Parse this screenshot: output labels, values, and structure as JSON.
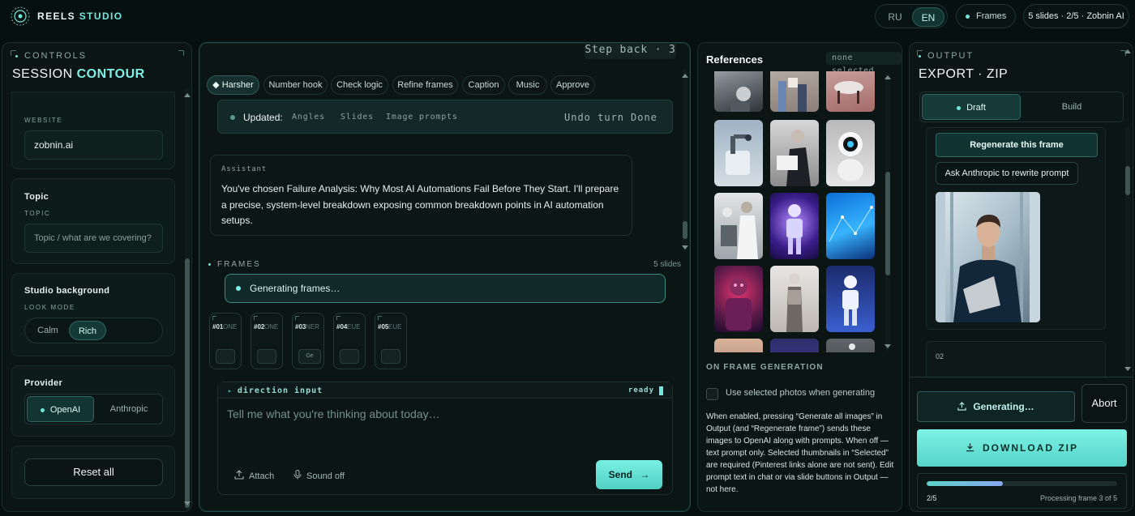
{
  "brand": {
    "name": "REELS",
    "accent": "STUDIO"
  },
  "topbar": {
    "lang_ru": "RU",
    "lang_en": "EN",
    "frames_label": "Frames",
    "status": "5 slides · 2/5 · Zobnin AI"
  },
  "controls": {
    "eyebrow": "CONTROLS",
    "title_plain": "SESSION",
    "title_accent": "CONTOUR",
    "website_label": "WEBSITE",
    "website_value": "zobnin.ai",
    "topic_title": "Topic",
    "topic_label": "TOPIC",
    "topic_placeholder": "Topic / what are we covering?",
    "bg_title": "Studio background",
    "look_label": "LOOK MODE",
    "look_calm": "Calm",
    "look_rich": "Rich",
    "provider_title": "Provider",
    "provider_openai": "OpenAI",
    "provider_anthropic": "Anthropic",
    "reset": "Reset all"
  },
  "center": {
    "step_back": "Step back · 3",
    "chips": [
      "◆ Harsher",
      "Number hook",
      "Check logic",
      "Refine frames",
      "Caption",
      "Music",
      "Approve"
    ],
    "updated_label": "Updated:",
    "updated_tags": [
      "Angles",
      "Slides",
      "Image prompts"
    ],
    "undo": "Undo turn",
    "done": "Done",
    "assistant_who": "Assistant",
    "assistant_msg": "You've chosen Failure Analysis: Why Most AI Automations Fail Before They Start. I'll prepare a precise, system-level breakdown exposing common breakdown points in AI automation setups.",
    "frames_head": "FRAMES",
    "frames_count": "5 slides",
    "generating": "Generating frames…",
    "thumbs": [
      {
        "n": "#01",
        "cap": "ONE",
        "btn": ""
      },
      {
        "n": "#02",
        "cap": "ONE",
        "btn": ""
      },
      {
        "n": "#03",
        "cap": "NER",
        "btn": "Ge"
      },
      {
        "n": "#04",
        "cap": "EUE",
        "btn": ""
      },
      {
        "n": "#05",
        "cap": "EUE",
        "btn": ""
      }
    ],
    "composer_title": "direction input",
    "composer_status": "ready",
    "composer_placeholder": "Tell me what you're thinking about today…",
    "attach": "Attach",
    "sound": "Sound off",
    "send": "Send"
  },
  "refs": {
    "title": "References",
    "selection": "none selected",
    "ofg_head": "ON FRAME GENERATION",
    "checkbox_label": "Use selected photos when generating",
    "ofg_text": "When enabled, pressing “Generate all images” in Output (and “Regenerate frame”) sends these images to OpenAI along with prompts. When off — text prompt only. Selected thumbnails in “Selected” are required (Pinterest links alone are not sent). Edit prompt text in chat or via slide buttons in Output — not here."
  },
  "output": {
    "eyebrow": "OUTPUT",
    "title": "EXPORT · ZIP",
    "tab_draft": "Draft",
    "tab_build": "Build",
    "regen": "Regenerate this frame",
    "ask": "Ask Anthropic to rewrite prompt",
    "frame2": "02",
    "generating": "Generating…",
    "abort": "Abort",
    "download": "DOWNLOAD ZIP",
    "progress_fraction": 0.4,
    "progress_label": "2/5",
    "progress_status": "Processing frame 3 of 5"
  },
  "colors": {
    "accent": "#6fe8dc",
    "background": "#06100f",
    "panel": "#0a1514"
  }
}
